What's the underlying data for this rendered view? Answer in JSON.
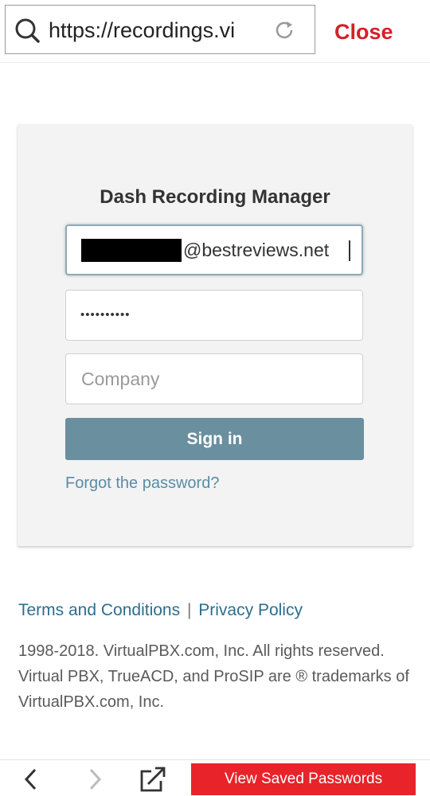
{
  "browser": {
    "url": "https://recordings.vi",
    "close_label": "Close",
    "icons": {
      "search": "search-icon",
      "reload": "reload-icon"
    }
  },
  "login": {
    "title": "Dash Recording Manager",
    "email_visible_text": "@bestreviews.net",
    "email_prefix_redacted": true,
    "password_mask": "••••••••••",
    "company_placeholder": "Company",
    "company_value": "",
    "sign_in_label": "Sign in",
    "forgot_label": "Forgot the password?"
  },
  "footer": {
    "terms_label": "Terms and Conditions",
    "separator": "|",
    "privacy_label": "Privacy Policy",
    "copyright": "1998-2018. VirtualPBX.com, Inc. All rights reserved. Virtual PBX, TrueACD, and ProSIP are ® trademarks of VirtualPBX.com, Inc."
  },
  "toolbar": {
    "view_saved_label": "View Saved Passwords",
    "icons": [
      "back-arrow-icon",
      "forward-arrow-icon",
      "open-external-icon"
    ]
  },
  "colors": {
    "accent_red": "#d32027",
    "button_red": "#e8232a",
    "sign_in_bg": "#6a8f9e",
    "link_blue": "#2d6e8e"
  }
}
